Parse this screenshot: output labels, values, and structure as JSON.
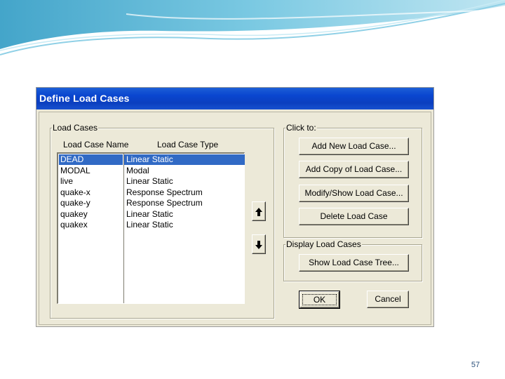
{
  "dialog": {
    "title": "Define Load Cases"
  },
  "load_cases_group": {
    "label": "Load Cases",
    "columns": [
      "Load Case Name",
      "Load Case Type"
    ],
    "rows": [
      {
        "name": "DEAD",
        "type": "Linear Static",
        "selected": true
      },
      {
        "name": "MODAL",
        "type": "Modal",
        "selected": false
      },
      {
        "name": "live",
        "type": "Linear Static",
        "selected": false
      },
      {
        "name": "quake-x",
        "type": "Response Spectrum",
        "selected": false
      },
      {
        "name": "quake-y",
        "type": "Response Spectrum",
        "selected": false
      },
      {
        "name": "quakey",
        "type": "Linear Static",
        "selected": false
      },
      {
        "name": "quakex",
        "type": "Linear Static",
        "selected": false
      }
    ]
  },
  "move_buttons": {
    "up_icon": "arrow-up-icon",
    "down_icon": "arrow-down-icon"
  },
  "click_to_group": {
    "label": "Click to:",
    "add_new": "Add New Load Case...",
    "add_copy": "Add Copy of Load Case...",
    "modify_show": "Modify/Show Load Case...",
    "delete": "Delete Load Case"
  },
  "display_group": {
    "label": "Display Load Cases",
    "show_tree": "Show Load Case Tree..."
  },
  "footer": {
    "ok": "OK",
    "cancel": "Cancel"
  },
  "slide": {
    "page_number": "57"
  },
  "colors": {
    "title_bar": "#0a46d0",
    "selection": "#316ac5",
    "dialog_face": "#ece9d8"
  }
}
